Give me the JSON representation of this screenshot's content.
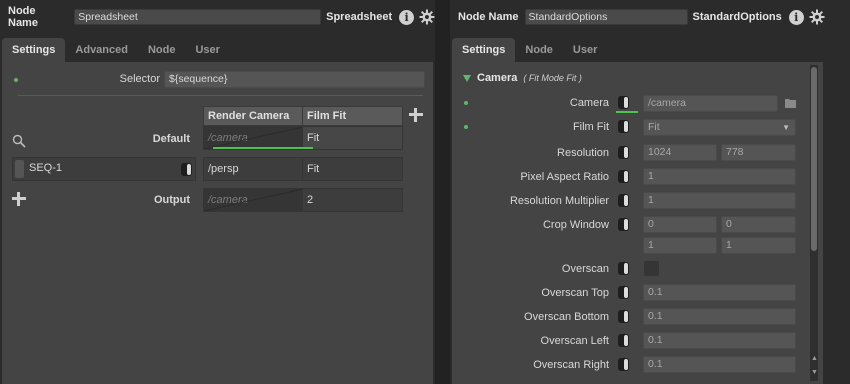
{
  "left": {
    "header": {
      "label": "Node Name",
      "node_name": "Spreadsheet",
      "node_type": "Spreadsheet"
    },
    "tabs": [
      "Settings",
      "Advanced",
      "Node",
      "User"
    ],
    "selector": {
      "label": "Selector",
      "value": "${sequence}"
    },
    "sheet": {
      "columns": [
        "Render Camera",
        "Film Fit"
      ],
      "rows": [
        {
          "label": "Default",
          "cells": [
            "/camera",
            "Fit"
          ]
        },
        {
          "label": "SEQ-1",
          "cells": [
            "/persp",
            "Fit"
          ]
        },
        {
          "label": "Output",
          "cells": [
            "/camera",
            "2"
          ]
        }
      ]
    }
  },
  "right": {
    "header": {
      "label": "Node Name",
      "node_name": "StandardOptions",
      "node_type": "StandardOptions"
    },
    "tabs": [
      "Settings",
      "Node",
      "User"
    ],
    "section": {
      "title": "Camera",
      "subtitle": "( Fit Mode Fit )"
    },
    "plugs": {
      "camera": {
        "label": "Camera",
        "value": "/camera"
      },
      "film_fit": {
        "label": "Film Fit",
        "value": "Fit"
      },
      "resolution": {
        "label": "Resolution",
        "x": "1024",
        "y": "778"
      },
      "pixel_aspect": {
        "label": "Pixel Aspect Ratio",
        "value": "1"
      },
      "res_mult": {
        "label": "Resolution Multiplier",
        "value": "1"
      },
      "crop": {
        "label": "Crop Window",
        "min_x": "0",
        "min_y": "0",
        "max_x": "1",
        "max_y": "1"
      },
      "overscan": {
        "label": "Overscan"
      },
      "overscan_top": {
        "label": "Overscan Top",
        "value": "0.1"
      },
      "overscan_bottom": {
        "label": "Overscan Bottom",
        "value": "0.1"
      },
      "overscan_left": {
        "label": "Overscan Left",
        "value": "0.1"
      },
      "overscan_right": {
        "label": "Overscan Right",
        "value": "0.1"
      }
    }
  },
  "colors": {
    "accent_green": "#4ec24e",
    "dot_green": "#5fb86a",
    "panel": "#444444"
  }
}
